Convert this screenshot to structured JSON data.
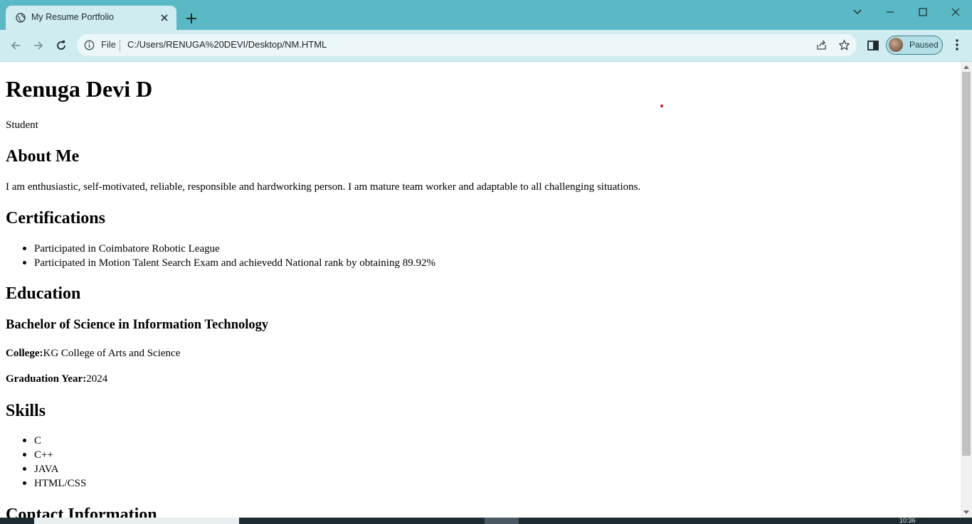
{
  "browser": {
    "tab_title": "My Resume Portfolio",
    "address_scheme": "File",
    "address_url": "C:/Users/RENUGA%20DEVI/Desktop/NM.HTML",
    "profile_label": "Paused",
    "accent_color": "#5bb9c5"
  },
  "page": {
    "name": "Renuga Devi D",
    "role": "Student",
    "about": {
      "heading": "About Me",
      "text": "I am enthusiastic, self-motivated, reliable, responsible and hardworking person. I am mature team worker and adaptable to all challenging situations."
    },
    "certifications": {
      "heading": "Certifications",
      "items": [
        "Participated in Coimbatore Robotic League",
        "Participated in Motion Talent Search Exam and achievedd National rank by obtaining 89.92%"
      ]
    },
    "education": {
      "heading": "Education",
      "degree": "Bachelor of Science in Information Technology",
      "college_label": "College:",
      "college_value": "KG College of Arts and Science",
      "year_label": "Graduation Year:",
      "year_value": "2024"
    },
    "skills": {
      "heading": "Skills",
      "items": [
        "C",
        "C++",
        "JAVA",
        "HTML/CSS"
      ]
    },
    "contact": {
      "heading": "Contact Information"
    }
  },
  "taskbar": {
    "clock": "10:36"
  }
}
